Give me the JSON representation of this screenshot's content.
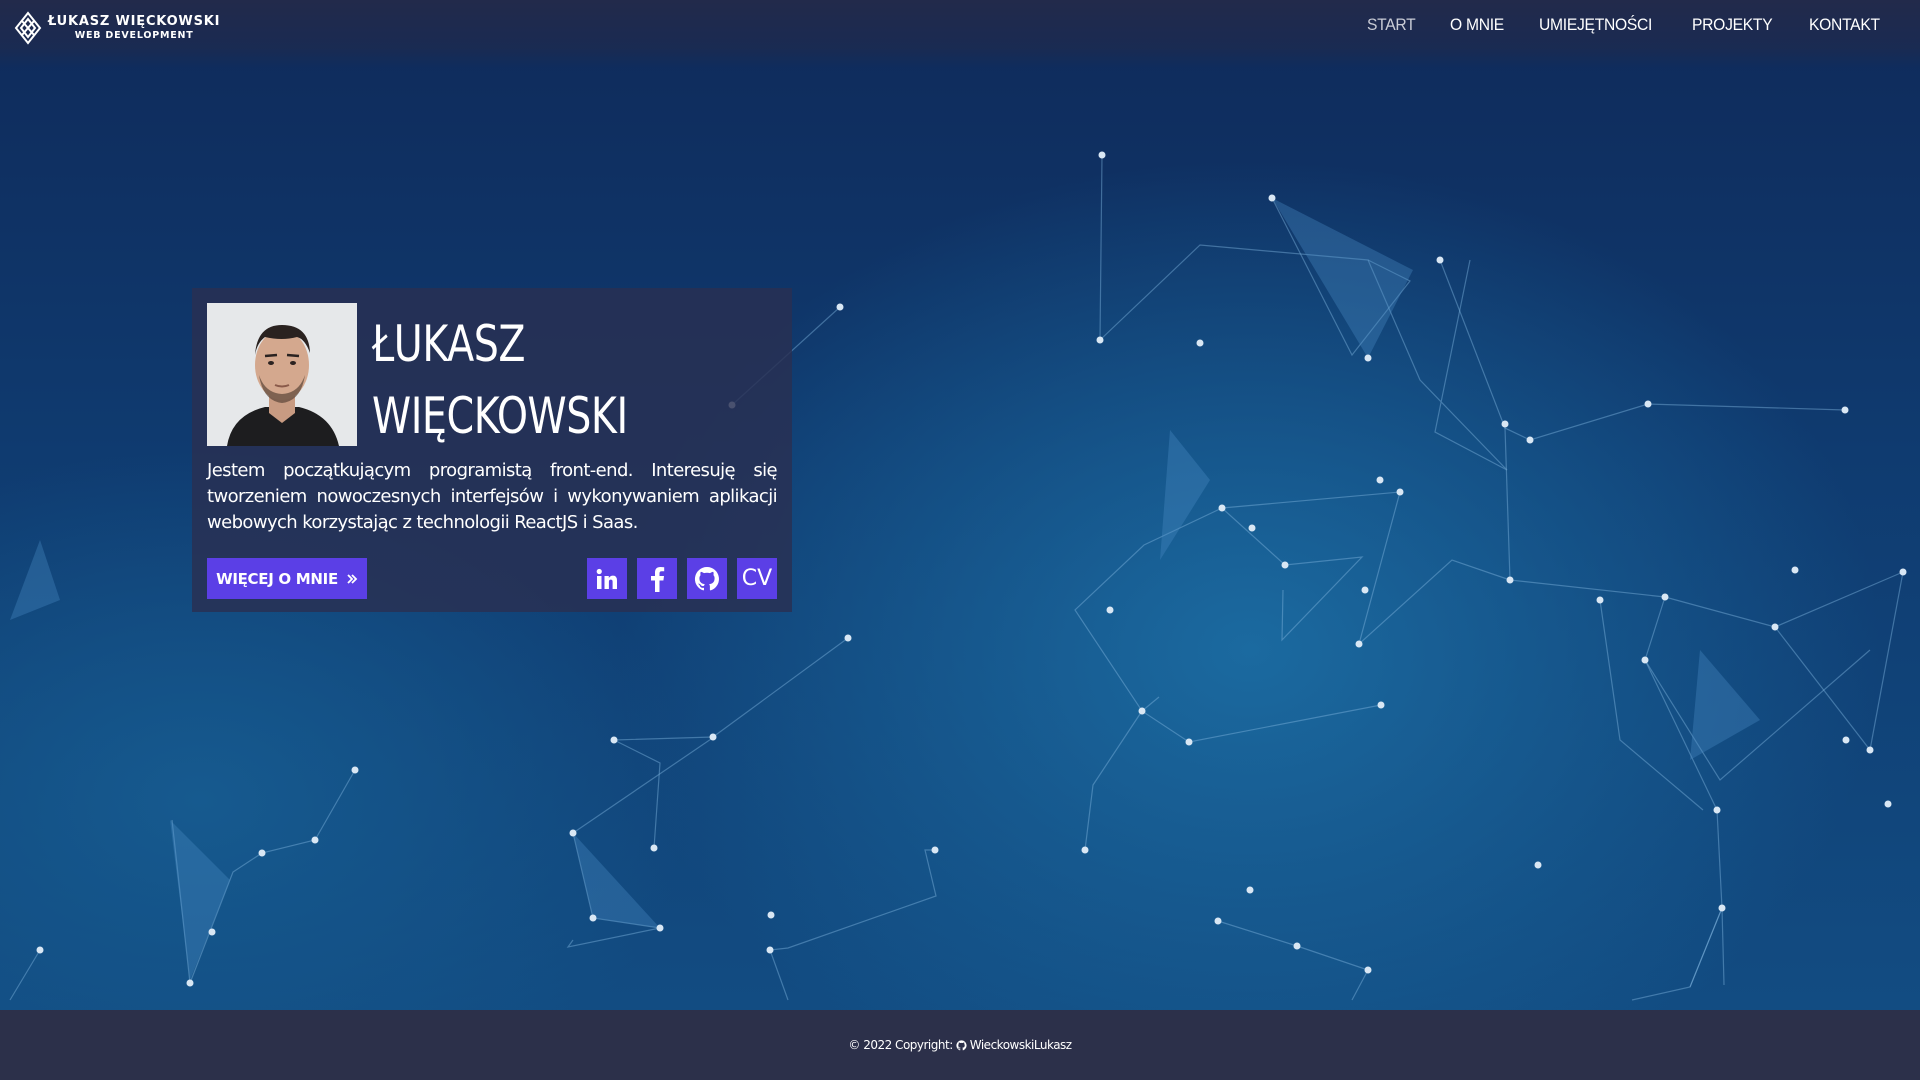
{
  "header": {
    "logo_name": "ŁUKASZ WIĘCKOWSKI",
    "logo_sub": "WEB DEVELOPMENT",
    "nav": [
      {
        "label": "START",
        "active": true
      },
      {
        "label": "O MNIE"
      },
      {
        "label": "UMIEJĘTNOŚCI"
      },
      {
        "label": "PROJEKTY"
      },
      {
        "label": "KONTAKT"
      }
    ]
  },
  "hero": {
    "name_line1": "ŁUKASZ",
    "name_line2": "WIĘCKOWSKI",
    "description": "Jestem początkującym programistą front-end. Interesuję się tworzeniem nowoczesnych interfejsów i wykonywaniem aplikacji webowych korzystając z technologii ReactJS i Saas.",
    "more_button": "WIĘCEJ O MNIE",
    "socials": [
      {
        "icon": "linkedin-icon"
      },
      {
        "icon": "facebook-icon"
      },
      {
        "icon": "github-icon"
      },
      {
        "icon": "cv-icon",
        "label": "CV"
      }
    ]
  },
  "footer": {
    "copyright": "© 2022 Copyright:",
    "author": "WieckowskiLukasz"
  },
  "colors": {
    "accent": "#5b3fe6",
    "card": "#2a3052",
    "footer": "#2c304a",
    "background": "#0f3b70"
  }
}
